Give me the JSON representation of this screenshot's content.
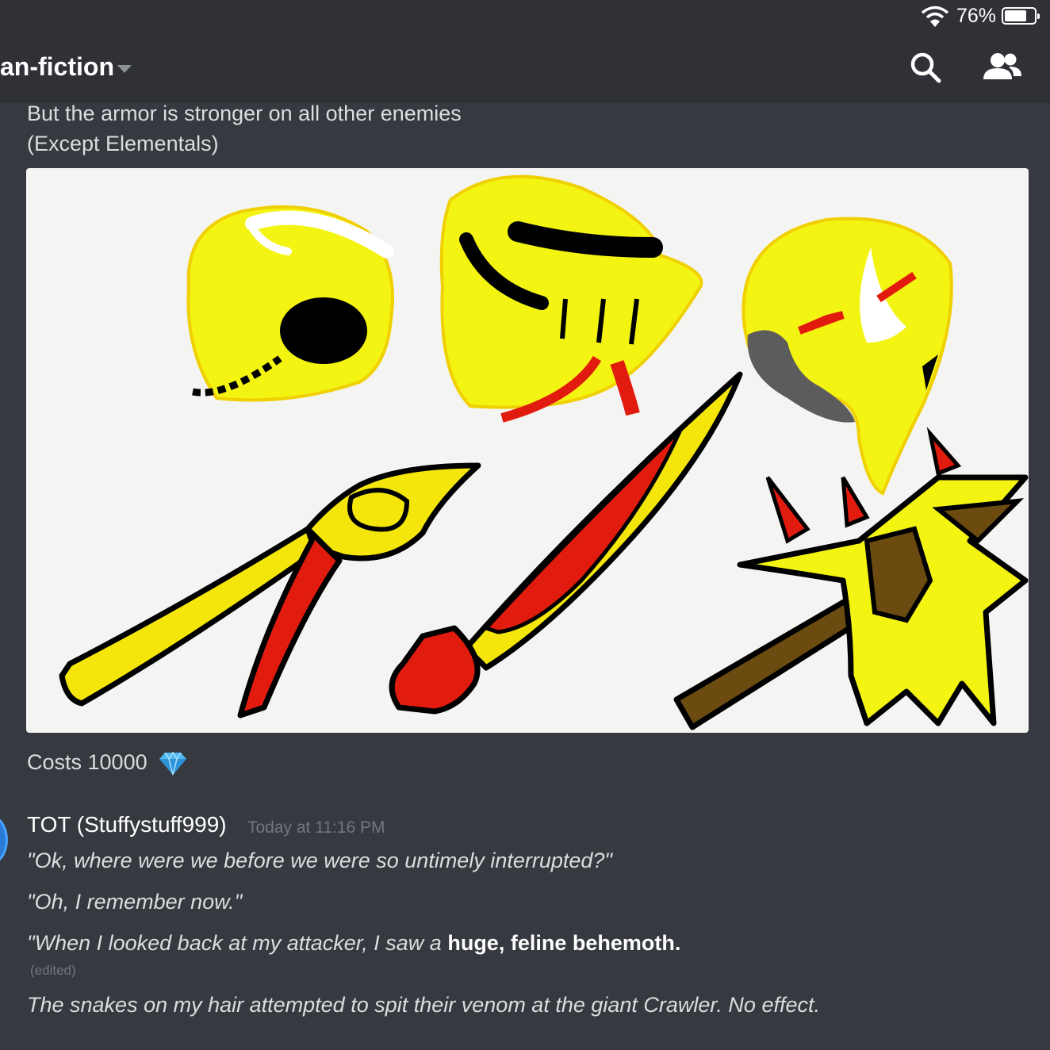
{
  "status_bar": {
    "battery_percent": "76%",
    "battery_level": 0.76
  },
  "header": {
    "channel_name": "an-fiction"
  },
  "messages": {
    "line1": "But the armor is stronger on all other enemies",
    "line2": "(Except Elementals)",
    "costs": "Costs 10000",
    "gem_icon": "gem-icon"
  },
  "post": {
    "author": "TOT (Stuffystuff999)",
    "timestamp": "Today at 11:16 PM",
    "quote1": "\"Ok, where were we before we were so untimely interrupted?\"",
    "quote2": "\"Oh, I remember now.\"",
    "quote3_start": "\"When I looked back at my attacker, I saw a ",
    "quote3_bold": "huge, feline behemoth.",
    "edited": "(edited)",
    "narration": "The snakes on my hair attempted to spit their venom at the giant Crawler. No effect."
  },
  "colors": {
    "background": "#36393f",
    "header": "#2f3136",
    "text": "#dcddde",
    "muted": "#72767d",
    "accent": "#2a7bd8"
  }
}
